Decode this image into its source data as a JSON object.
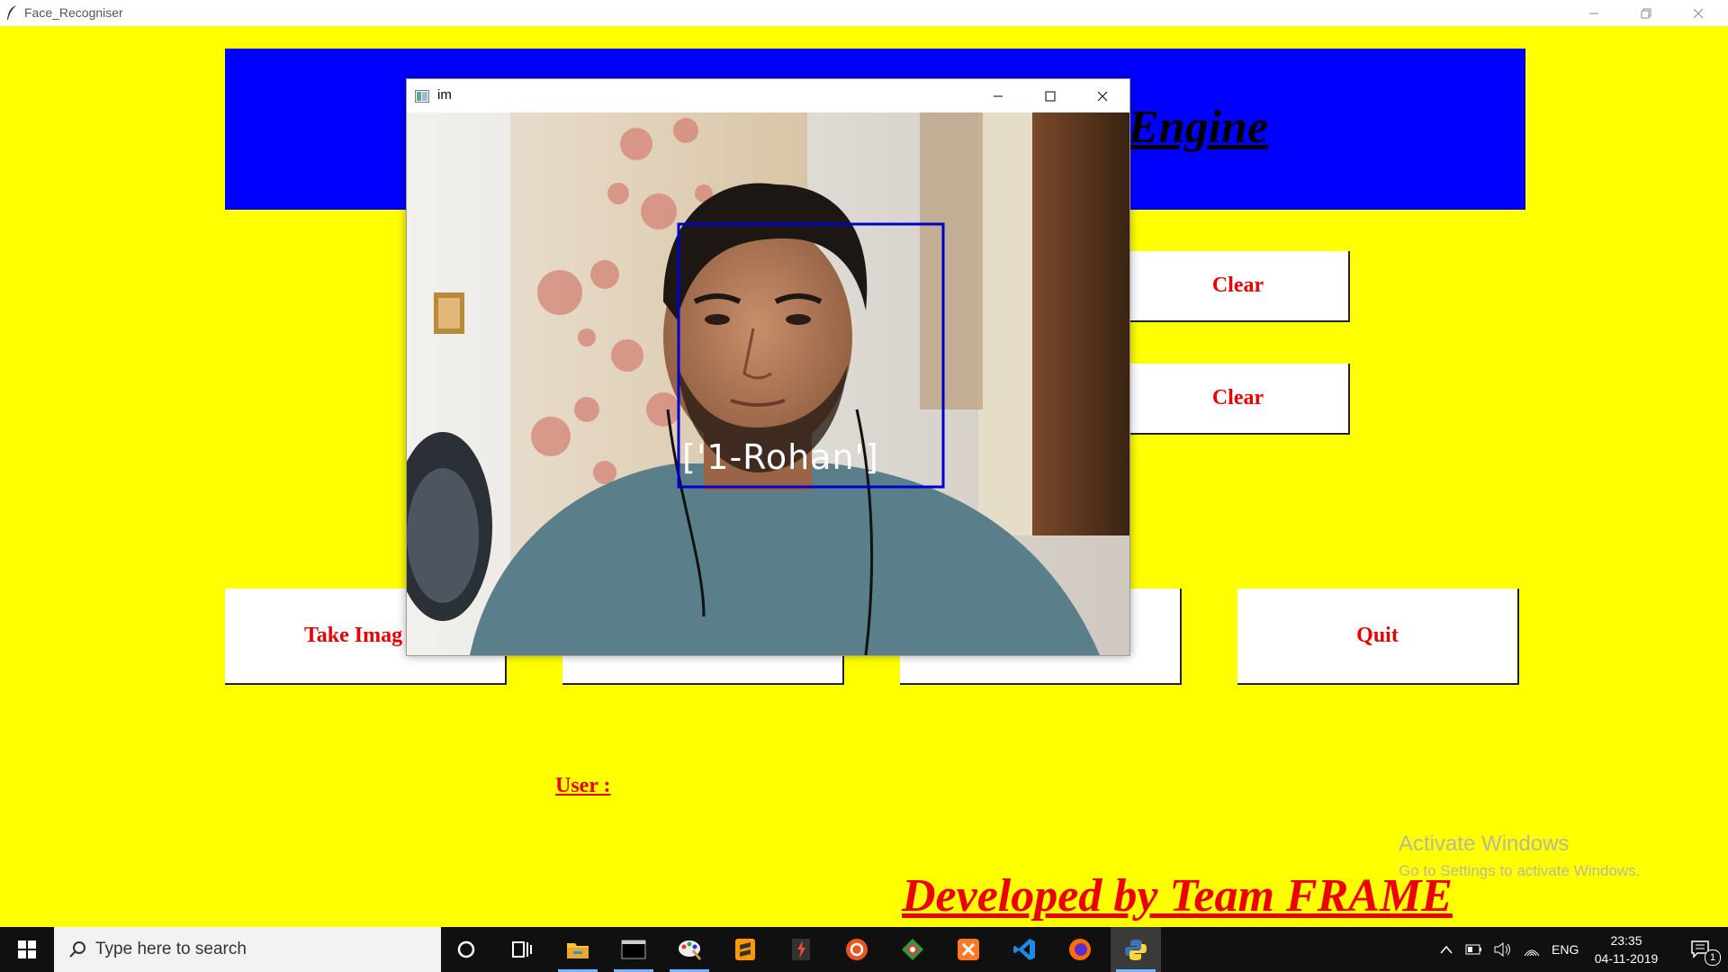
{
  "window": {
    "title": "Face_Recogniser"
  },
  "banner": {
    "visible_text": "Engine"
  },
  "buttons": {
    "clear_1": "Clear",
    "clear_2": "Clear",
    "take_images": "Take Imag",
    "quit": "Quit"
  },
  "user_label": "User :",
  "footer": "Developed by Team FRAME",
  "watermark": {
    "line1": "Activate Windows",
    "line2": "Go to Settings to activate Windows."
  },
  "camera_window": {
    "title": "im",
    "detection_label": "['1-Rohan']"
  },
  "taskbar": {
    "search_placeholder": "Type here to search",
    "language": "ENG",
    "time": "23:35",
    "date": "04-11-2019",
    "notification_count": "1",
    "apps": [
      "cortana",
      "task-view",
      "file-explorer",
      "terminal",
      "paint",
      "sublime-text",
      "git",
      "ubuntu",
      "sourcetree",
      "xampp",
      "vscode",
      "firefox",
      "python"
    ]
  },
  "colors": {
    "background": "#ffff00",
    "banner": "#0000ff",
    "button_text": "#ee0000",
    "detection_box": "#0000cc"
  }
}
